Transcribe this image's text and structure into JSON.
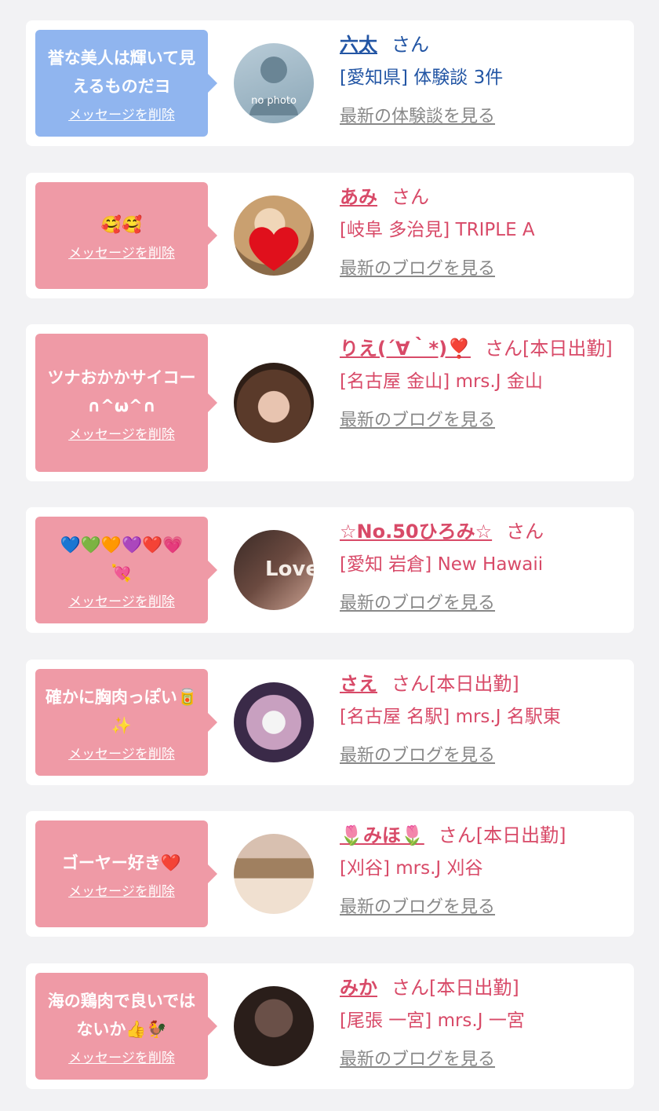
{
  "items": [
    {
      "theme": "blue",
      "message": "誉な美人は輝いて見えるものだヨ",
      "delete_label": "メッセージを削除",
      "name": "六太",
      "honorific": "さん",
      "shop": "[愛知県] 体験談 3件",
      "more_label": "最新の体験談を見る",
      "avatar": "no-photo-placeholder",
      "avatar_text": "no photo"
    },
    {
      "theme": "pink",
      "message": "🥰🥰",
      "delete_label": "メッセージを削除",
      "name": "あみ",
      "honorific": "さん",
      "shop": "[岐阜 多治見] TRIPLE A",
      "more_label": "最新のブログを見る",
      "avatar": "photo-blonde-heart"
    },
    {
      "theme": "pink",
      "message": "ツナおかかサイコー∩^ω^∩",
      "delete_label": "メッセージを削除",
      "name": "りえ(´∀｀*)❣️",
      "honorific": "さん[本日出勤]",
      "shop": "[名古屋 金山] mrs.J 金山",
      "more_label": "最新のブログを見る",
      "avatar": "photo-brown-hair"
    },
    {
      "theme": "pink",
      "message": "💙💚🧡💜❤️💗💘",
      "delete_label": "メッセージを削除",
      "name": "☆No.50ひろみ☆",
      "honorific": "さん",
      "shop": "[愛知 岩倉] New Hawaii",
      "more_label": "最新のブログを見る",
      "avatar": "photo-love-text"
    },
    {
      "theme": "pink",
      "message": "確かに胸肉っぽい🥫✨",
      "delete_label": "メッセージを削除",
      "name": "さえ",
      "honorific": "さん[本日出勤]",
      "shop": "[名古屋 名駅] mrs.J 名駅東",
      "more_label": "最新のブログを見る",
      "avatar": "photo-mask"
    },
    {
      "theme": "pink",
      "message": "ゴーヤー好き❤️",
      "delete_label": "メッセージを削除",
      "name": "🌷みほ🌷",
      "honorific": "さん[本日出勤]",
      "shop": "[刈谷] mrs.J 刈谷",
      "more_label": "最新のブログを見る",
      "avatar": "photo-peace-sign"
    },
    {
      "theme": "pink",
      "message": "海の鶏肉で良いではないか👍🐓",
      "delete_label": "メッセージを削除",
      "name": "みか",
      "honorific": "さん[本日出勤]",
      "shop": "[尾張 一宮] mrs.J 一宮",
      "more_label": "最新のブログを見る",
      "avatar": "photo-legs-dark"
    }
  ],
  "colors": {
    "blue_bubble": "#90b5ef",
    "pink_bubble": "#ef9aa6",
    "blue_text": "#2255a4",
    "pink_text": "#d84a68",
    "link_gray": "#888888",
    "page_bg": "#f2f2f4"
  }
}
